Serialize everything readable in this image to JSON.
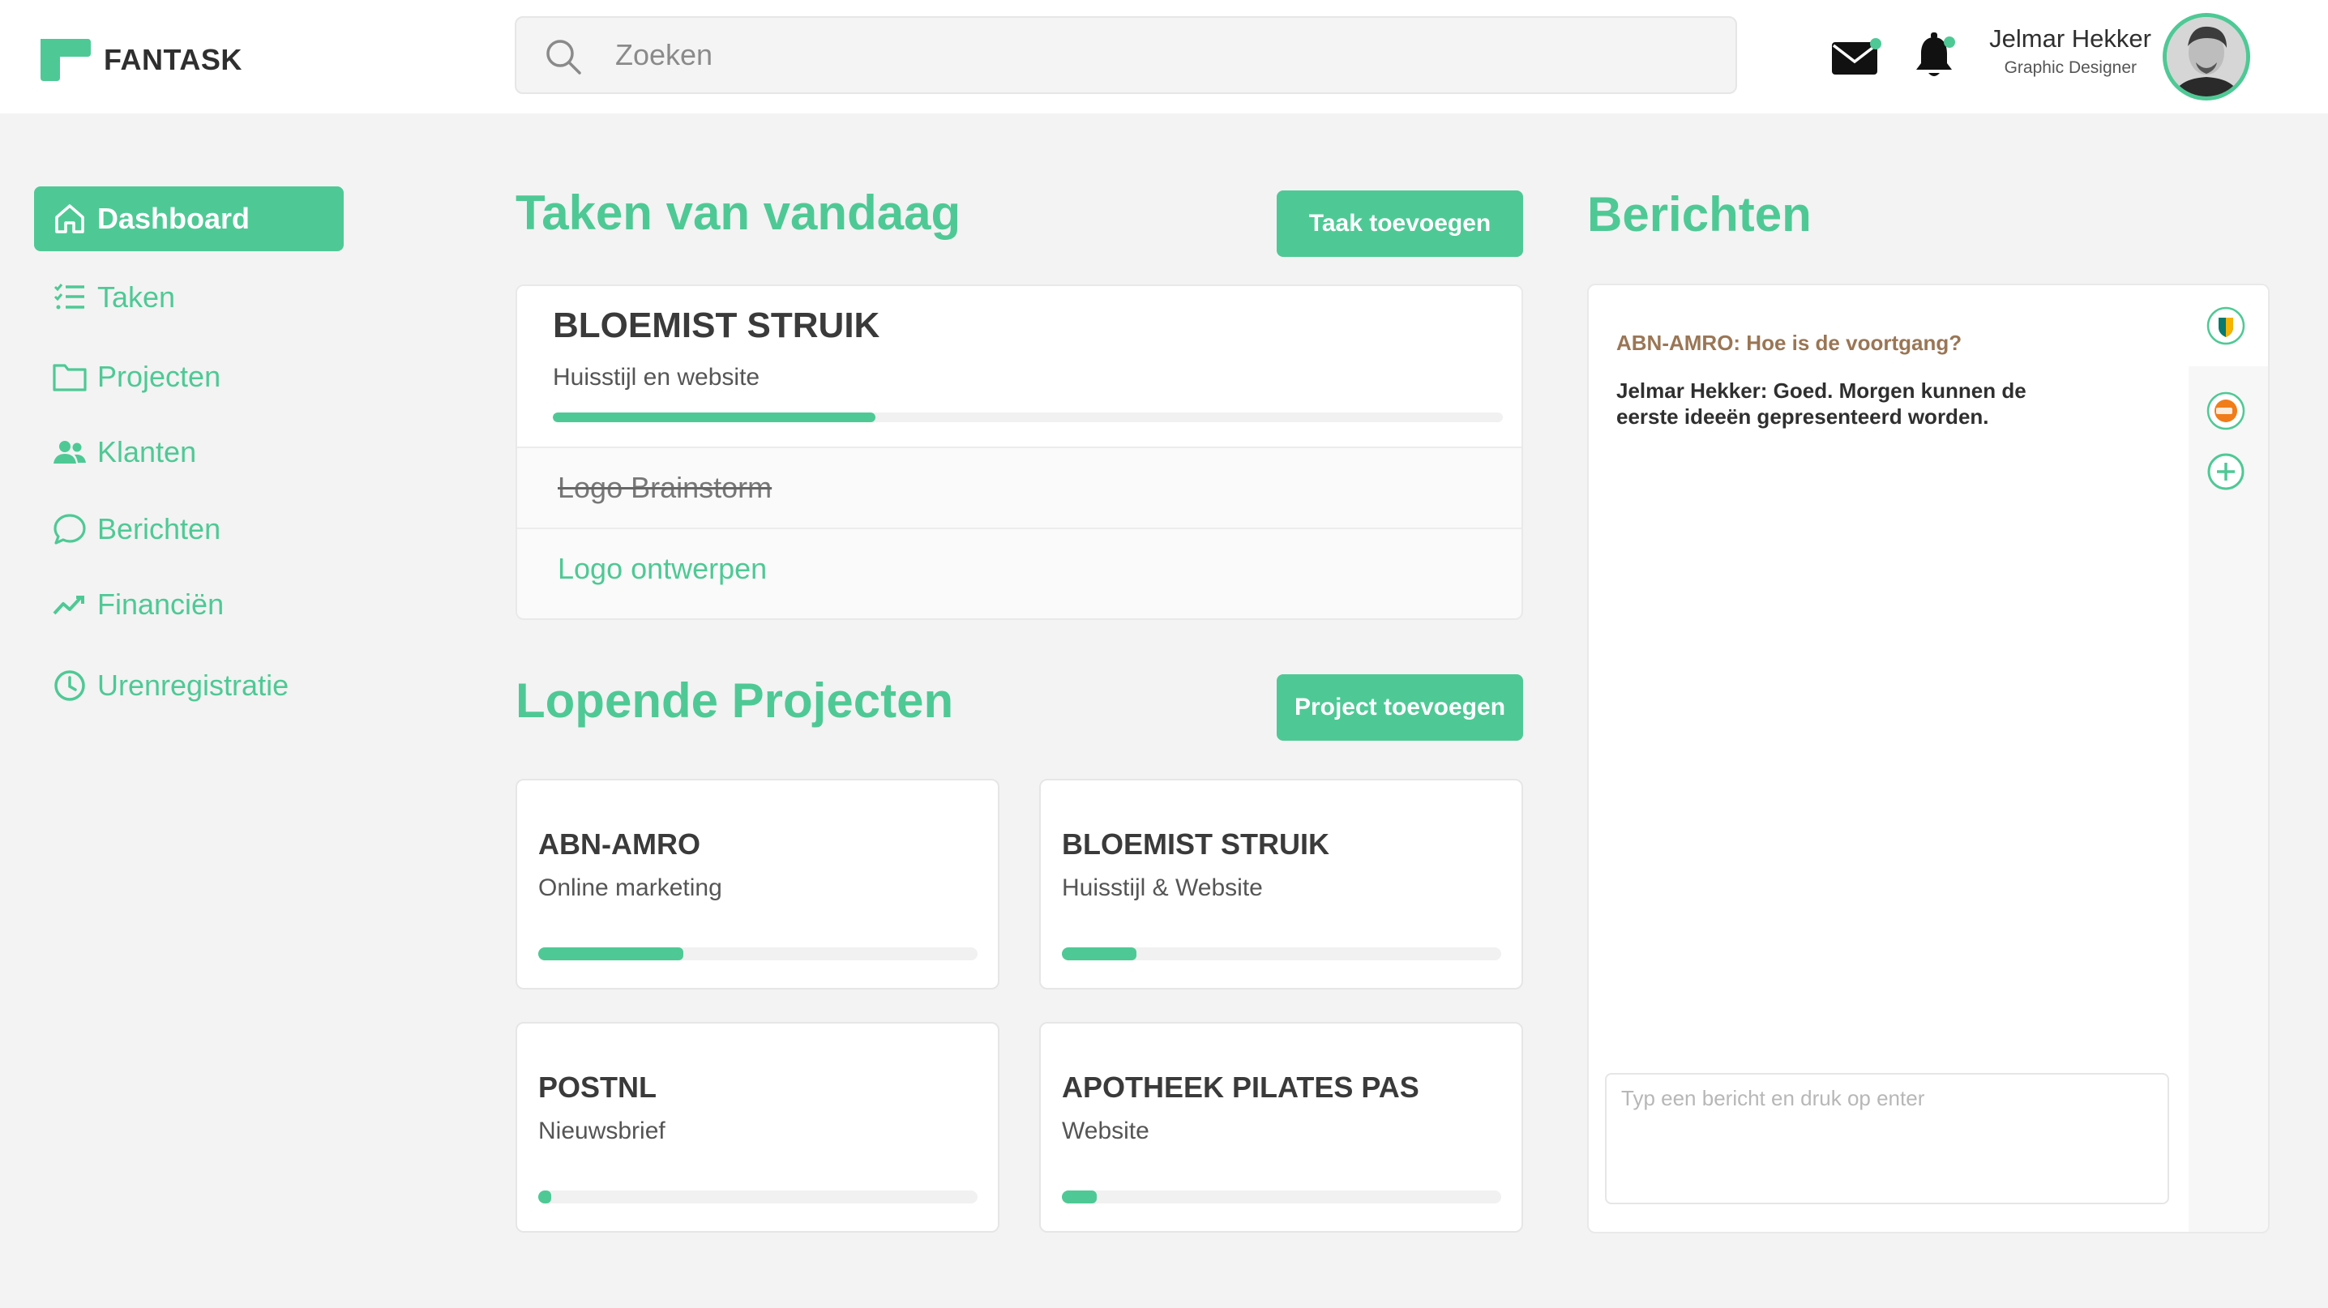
{
  "app": {
    "name": "FANTASK"
  },
  "colors": {
    "accent": "#4ec995",
    "background": "#f3f3f3",
    "message_subject": "#9a7655"
  },
  "search": {
    "placeholder": "Zoeken",
    "value": ""
  },
  "header": {
    "user_name": "Jelmar Hekker",
    "user_role": "Graphic Designer",
    "icons": [
      "mail-icon",
      "bell-icon"
    ]
  },
  "sidebar": {
    "items": [
      {
        "label": "Dashboard",
        "icon": "home-icon",
        "active": true
      },
      {
        "label": "Taken",
        "icon": "checklist-icon",
        "active": false
      },
      {
        "label": "Projecten",
        "icon": "folder-icon",
        "active": false
      },
      {
        "label": "Klanten",
        "icon": "people-icon",
        "active": false
      },
      {
        "label": "Berichten",
        "icon": "chat-bubble-icon",
        "active": false
      },
      {
        "label": "Financiën",
        "icon": "trend-line-icon",
        "active": false
      },
      {
        "label": "Urenregistratie",
        "icon": "clock-icon",
        "active": false
      }
    ]
  },
  "tasks": {
    "title": "Taken van vandaag",
    "add_button": "Taak toevoegen",
    "main": {
      "client": "BLOEMIST STRUIK",
      "subtitle": "Huisstijl en website",
      "progress": 0.34
    },
    "items": [
      {
        "label": "Logo Brainstorm",
        "done": true
      },
      {
        "label": "Logo ontwerpen",
        "done": false
      }
    ]
  },
  "projects": {
    "title": "Lopende Projecten",
    "add_button": "Project toevoegen",
    "items": [
      {
        "client": "ABN-AMRO",
        "subtitle": "Online marketing",
        "progress": 0.33
      },
      {
        "client": "BLOEMIST STRUIK",
        "subtitle": "Huisstijl & Website",
        "progress": 0.17
      },
      {
        "client": "POSTNL",
        "subtitle": "Nieuwsbrief",
        "progress": 0.03
      },
      {
        "client": "APOTHEEK PILATES PAS",
        "subtitle": "Website",
        "progress": 0.08
      }
    ]
  },
  "messages": {
    "title": "Berichten",
    "subject": "ABN-AMRO: Hoe is de voortgang?",
    "reply": "Jelmar Hekker: Goed. Morgen kunnen de eerste ideeën gepresenteerd worden.",
    "input_placeholder": "Typ een bericht en druk op enter",
    "rail_icons": [
      "abn-amro-logo-icon",
      "postnl-logo-icon",
      "add-conversation-icon"
    ]
  }
}
